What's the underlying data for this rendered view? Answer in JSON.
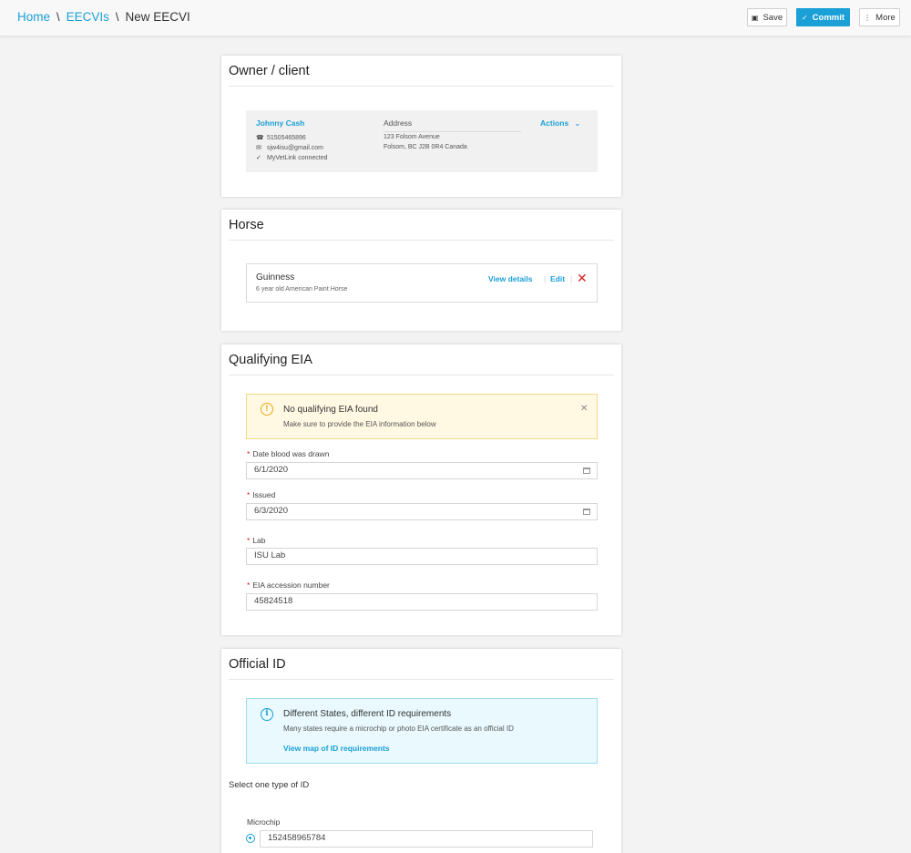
{
  "breadcrumb": {
    "items": [
      "Home",
      "EECVIs"
    ],
    "separator": "\\",
    "current": "New EECVI"
  },
  "toolbar": {
    "save_label": "Save",
    "commit_label": "Commit",
    "more_label": "More"
  },
  "owner": {
    "title": "Owner / client",
    "name": "Johnny Cash",
    "phone": "51505465896",
    "email": "sjw4isu@gmail.com",
    "myvetlink": "MyVetLink connected",
    "address_label": "Address",
    "address_line1": "123 Folsom Avenue",
    "address_line2": "Folsom, BC J2B 0R4 Canada",
    "actions_label": "Actions"
  },
  "horse": {
    "title": "Horse",
    "name": "Guinness",
    "description": "6 year old American Paint Horse",
    "view_details_label": "View details",
    "edit_label": "Edit"
  },
  "eia": {
    "title": "Qualifying EIA",
    "alert_title": "No qualifying EIA found",
    "alert_subtitle": "Make sure to provide the EIA information below",
    "date_drawn_label": "Date blood was drawn",
    "date_drawn_value": "6/1/2020",
    "issued_label": "Issued",
    "issued_value": "6/3/2020",
    "lab_label": "Lab",
    "lab_value": "ISU Lab",
    "accession_label": "EIA accession number",
    "accession_value": "45824518"
  },
  "official_id": {
    "title": "Official ID",
    "info_title": "Different States, different ID requirements",
    "info_subtitle": "Many states require a microchip or photo EIA certificate as an official ID",
    "info_link": "View map of ID requirements",
    "select_label": "Select one type of ID",
    "microchip_label": "Microchip",
    "microchip_value": "152458965784"
  },
  "colors": {
    "accent": "#1a9fd6",
    "required": "#e02020",
    "warning": "#e6a817"
  }
}
